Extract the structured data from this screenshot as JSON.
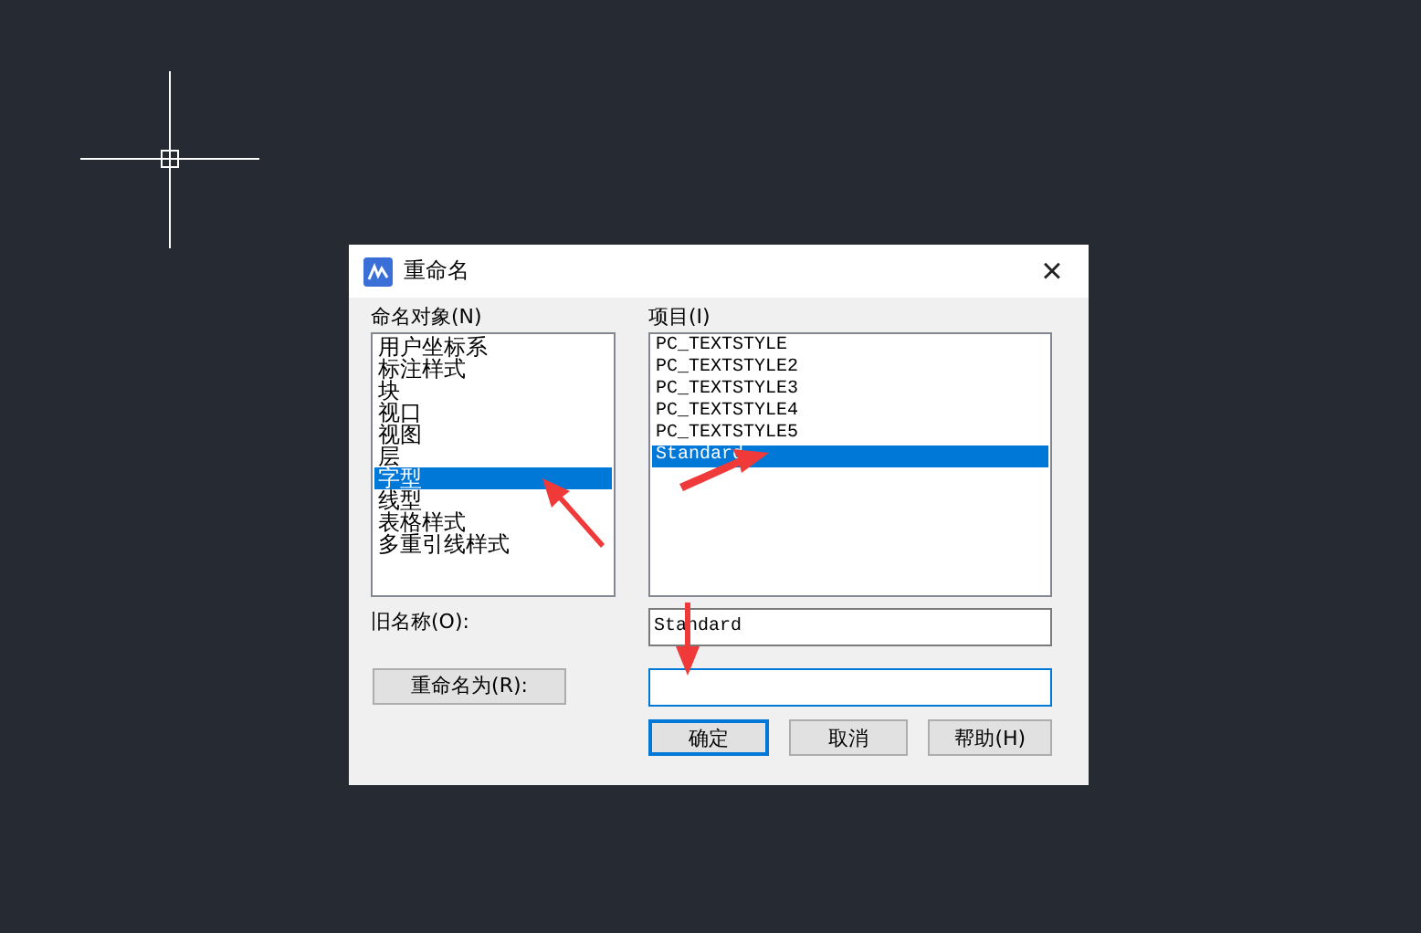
{
  "dialog": {
    "title": "重命名",
    "close": "×",
    "objects_label": "命名对象(N)",
    "objects": [
      {
        "label": "用户坐标系",
        "selected": false
      },
      {
        "label": "标注样式",
        "selected": false
      },
      {
        "label": "块",
        "selected": false
      },
      {
        "label": "视口",
        "selected": false
      },
      {
        "label": "视图",
        "selected": false
      },
      {
        "label": "层",
        "selected": false
      },
      {
        "label": "字型",
        "selected": true
      },
      {
        "label": "线型",
        "selected": false
      },
      {
        "label": "表格样式",
        "selected": false
      },
      {
        "label": "多重引线样式",
        "selected": false
      }
    ],
    "items_label": "项目(I)",
    "items": [
      {
        "label": "PC_TEXTSTYLE",
        "selected": false
      },
      {
        "label": "PC_TEXTSTYLE2",
        "selected": false
      },
      {
        "label": "PC_TEXTSTYLE3",
        "selected": false
      },
      {
        "label": "PC_TEXTSTYLE4",
        "selected": false
      },
      {
        "label": "PC_TEXTSTYLE5",
        "selected": false
      },
      {
        "label": "Standard",
        "selected": true
      }
    ],
    "old_name_label": "旧名称(O):",
    "old_name": "Standard",
    "rename_button": "重命名为(R):",
    "buttons": [
      {
        "label": "确定",
        "default": true
      },
      {
        "label": "取消",
        "default": false
      },
      {
        "label": "帮助(H)",
        "default": false
      }
    ]
  }
}
